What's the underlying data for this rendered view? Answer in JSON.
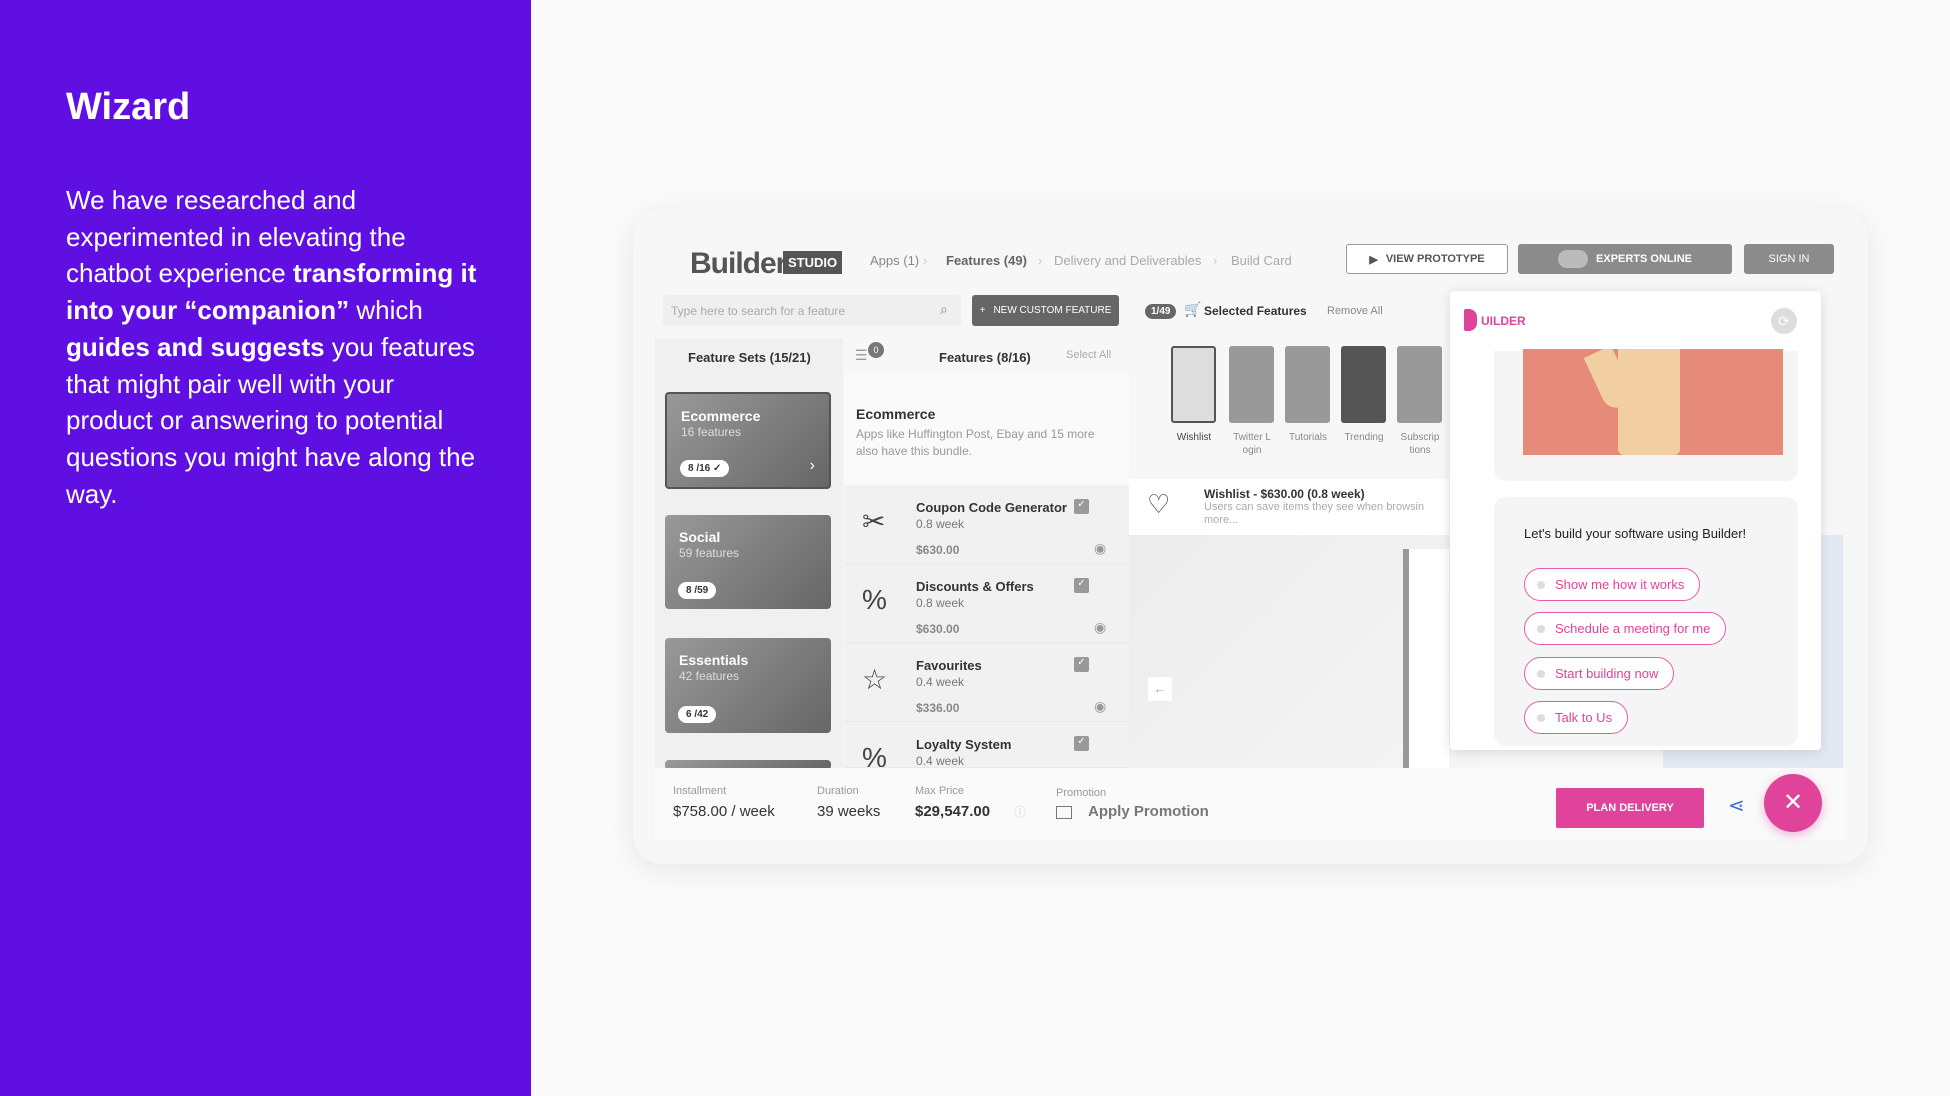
{
  "intro": {
    "title": "Wizard",
    "p1": "We have researched and experimented in elevating the chatbot experience ",
    "b1": "transforming it into your “companion”",
    "p2": " which ",
    "b2": "guides and suggests",
    "p3": " you features that might pair well with your product or answering to potential questions you might have along the way."
  },
  "app": {
    "logo": "Builder",
    "logo_badge": "STUDIO",
    "breadcrumb": [
      "Apps (1)",
      "Features (49)",
      "Delivery and Deliverables",
      "Build Card"
    ],
    "view_prototype": "VIEW PROTOTYPE",
    "experts_online": "EXPERTS ONLINE",
    "sign_in": "SIGN IN",
    "search_placeholder": "Type here to search for a feature",
    "new_custom_feature": "NEW CUSTOM FEATURE",
    "feature_sets_header": "Feature Sets (15/21)",
    "features_header": "Features (8/16)",
    "filter_count": "0",
    "select_all": "Select All",
    "sets": [
      {
        "name": "Ecommerce",
        "count": "16 features",
        "badge": "8 /16 ✓"
      },
      {
        "name": "Social",
        "count": "59 features",
        "badge": "8 /59"
      },
      {
        "name": "Essentials",
        "count": "42 features",
        "badge": "6 /42"
      }
    ],
    "bundle": {
      "title": "Ecommerce",
      "desc": "Apps like Huffington Post, Ebay and 15 more also have this bundle."
    },
    "features": [
      {
        "name": "Coupon Code Generator",
        "duration": "0.8 week",
        "price": "$630.00",
        "icon": "coupon-icon"
      },
      {
        "name": "Discounts & Offers",
        "duration": "0.8 week",
        "price": "$630.00",
        "icon": "percent-badge-icon"
      },
      {
        "name": "Favourites",
        "duration": "0.4 week",
        "price": "$336.00",
        "icon": "star-icon"
      },
      {
        "name": "Loyalty System",
        "duration": "0.4 week",
        "price": "",
        "icon": "percent-badge-icon"
      }
    ],
    "selected": {
      "count": "1/49",
      "label": "Selected Features",
      "remove_all": "Remove All",
      "thumbs": [
        "Wishlist",
        "Twitter L ogin",
        "Tutorials",
        "Trending",
        "Subscrip tions"
      ]
    },
    "detail": {
      "title": "Wishlist - $630.00 (0.8 week)",
      "desc": "Users can save items they see when browsin",
      "more": "more..."
    },
    "footer": {
      "installment_label": "Installment",
      "installment": "$758.00 / week",
      "duration_label": "Duration",
      "duration": "39 weeks",
      "max_price_label": "Max Price",
      "max_price": "$29,547.00",
      "promotion_label": "Promotion",
      "apply_promotion": "Apply Promotion",
      "plan_delivery": "PLAN DELIVERY"
    },
    "chat": {
      "brand": "UILDER",
      "message": "Let's build your software using Builder!",
      "options": [
        "Show me how it works",
        "Schedule a meeting for me",
        "Start building now",
        "Talk to Us"
      ]
    }
  },
  "colors": {
    "purple": "#600fe2",
    "pink": "#e0439a",
    "coral": "#e68a7a"
  }
}
